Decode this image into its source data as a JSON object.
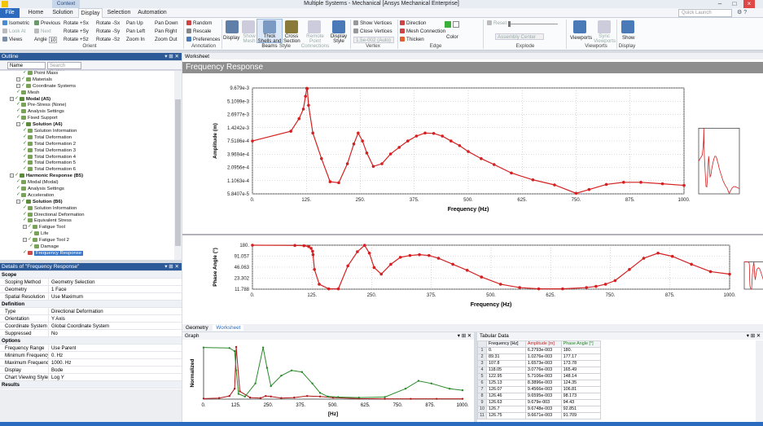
{
  "window": {
    "title": "Multiple Systems - Mechanical [Ansys Mechanical Enterprise]",
    "context_tab": "Context",
    "quick_launch_placeholder": "Quick Launch"
  },
  "ribbon_tabs": [
    "File",
    "Home",
    "Solution",
    "Display",
    "Selection",
    "Automation"
  ],
  "ribbon": {
    "orient": {
      "isometric": "Isometric",
      "look_at": "Look At",
      "views": "Views",
      "previous": "Previous",
      "next": "Next",
      "angle_label": "Angle",
      "angle_value": "10",
      "rotate_px": "Rotate +Sx",
      "rotate_py": "Rotate +Sy",
      "rotate_pz": "Rotate +Sz",
      "rotate_nx": "Rotate -Sx",
      "rotate_ny": "Rotate -Sy",
      "rotate_nz": "Rotate -Sz",
      "pan_up": "Pan Up",
      "pan_left": "Pan Left",
      "zoom_in": "Zoom In",
      "pan_down": "Pan Down",
      "pan_right": "Pan Right",
      "zoom_out": "Zoom Out",
      "group": "Orient"
    },
    "annotation": {
      "random": "Random",
      "rescale": "Rescale",
      "preferences": "Preferences",
      "group": "Annotation"
    },
    "style": {
      "display": "Display",
      "show_mesh": "Show Mesh",
      "thick_shells": "Thick Shells and Beams",
      "cross_section": "Cross Section",
      "remote_point": "Remote Point Connections",
      "display_style": "Display Style",
      "group": "Style"
    },
    "vertex": {
      "show_vertices": "Show Vertices",
      "close_vertices": "Close Vertices",
      "vertex_value": "1.5e-002 (Auto)",
      "group": "Vertex"
    },
    "edge": {
      "direction": "Direction",
      "mesh_connection": "Mesh Connection",
      "thicken": "Thicken",
      "color": "Color",
      "group": "Edge"
    },
    "explode": {
      "reset": "Reset",
      "assembly_center": "Assembly Center",
      "group": "Explode"
    },
    "viewports": {
      "viewports": "Viewports",
      "sync": "Sync Viewports",
      "group": "Viewports"
    },
    "display": {
      "show": "Show",
      "group": "Display"
    }
  },
  "outline": {
    "title": "Outline",
    "name_col": "Name",
    "search_placeholder": "Search Outline",
    "nodes": [
      {
        "label": "Point Mass",
        "depth": 2,
        "kind": "leaf"
      },
      {
        "label": "Materials",
        "depth": 1,
        "kind": "folder"
      },
      {
        "label": "Coordinate Systems",
        "depth": 1,
        "kind": "folder"
      },
      {
        "label": "Mesh",
        "depth": 1,
        "kind": "leaf"
      },
      {
        "label": "Modal (A5)",
        "depth": 0,
        "kind": "bold"
      },
      {
        "label": "Pre-Stress (None)",
        "depth": 1,
        "kind": "leaf"
      },
      {
        "label": "Analysis Settings",
        "depth": 1,
        "kind": "leaf"
      },
      {
        "label": "Fixed Support",
        "depth": 1,
        "kind": "leaf"
      },
      {
        "label": "Solution (A6)",
        "depth": 1,
        "kind": "bold"
      },
      {
        "label": "Solution Information",
        "depth": 2,
        "kind": "leaf"
      },
      {
        "label": "Total Deformation",
        "depth": 2,
        "kind": "leaf"
      },
      {
        "label": "Total Deformation 2",
        "depth": 2,
        "kind": "leaf"
      },
      {
        "label": "Total Deformation 3",
        "depth": 2,
        "kind": "leaf"
      },
      {
        "label": "Total Deformation 4",
        "depth": 2,
        "kind": "leaf"
      },
      {
        "label": "Total Deformation 5",
        "depth": 2,
        "kind": "leaf"
      },
      {
        "label": "Total Deformation 6",
        "depth": 2,
        "kind": "leaf"
      },
      {
        "label": "Harmonic Response (B5)",
        "depth": 0,
        "kind": "bold"
      },
      {
        "label": "Modal (Modal)",
        "depth": 1,
        "kind": "leaf"
      },
      {
        "label": "Analysis Settings",
        "depth": 1,
        "kind": "leaf"
      },
      {
        "label": "Acceleration",
        "depth": 1,
        "kind": "leaf"
      },
      {
        "label": "Solution (B6)",
        "depth": 1,
        "kind": "bold"
      },
      {
        "label": "Solution Information",
        "depth": 2,
        "kind": "leaf"
      },
      {
        "label": "Directional Deformation",
        "depth": 2,
        "kind": "leaf"
      },
      {
        "label": "Equivalent Stress",
        "depth": 2,
        "kind": "leaf"
      },
      {
        "label": "Fatigue Tool",
        "depth": 2,
        "kind": "folder"
      },
      {
        "label": "Life",
        "depth": 3,
        "kind": "leaf"
      },
      {
        "label": "Fatigue Tool 2",
        "depth": 2,
        "kind": "folder"
      },
      {
        "label": "Damage",
        "depth": 3,
        "kind": "leaf"
      },
      {
        "label": "Frequency Response",
        "depth": 2,
        "kind": "selected"
      }
    ]
  },
  "details": {
    "title": "Details of \"Frequency Response\"",
    "rows": [
      {
        "k": "Scope",
        "section": true
      },
      {
        "k": "Scoping Method",
        "v": "Geometry Selection"
      },
      {
        "k": "Geometry",
        "v": "1 Face"
      },
      {
        "k": "Spatial Resolution",
        "v": "Use Maximum"
      },
      {
        "k": "Definition",
        "section": true
      },
      {
        "k": "Type",
        "v": "Directional Deformation"
      },
      {
        "k": "Orientation",
        "v": "Y Axis"
      },
      {
        "k": "Coordinate System",
        "v": "Global Coordinate System"
      },
      {
        "k": "Suppressed",
        "v": "No"
      },
      {
        "k": "Options",
        "section": true
      },
      {
        "k": "Frequency Range",
        "v": "Use Parent"
      },
      {
        "k": "Minimum Frequency",
        "v": "0. Hz"
      },
      {
        "k": "Maximum Frequency",
        "v": "1000. Hz"
      },
      {
        "k": "Display",
        "v": "Bode"
      },
      {
        "k": "Chart Viewing Style",
        "v": "Log Y"
      },
      {
        "k": "Results",
        "section": true
      }
    ]
  },
  "worksheet": {
    "tab_label": "Worksheet",
    "header": "Frequency Response"
  },
  "bottom_tabs": [
    "Geometry",
    "Worksheet"
  ],
  "graph_panel": {
    "title": "Graph"
  },
  "tabular": {
    "title": "Tabular Data",
    "columns": [
      "Frequency [Hz]",
      "Amplitude [m]",
      "Phase Angle [°]"
    ],
    "rows": [
      [
        "0.",
        "6.2793e-003",
        "180."
      ],
      [
        "89.31",
        "1.0276e-003",
        "177.17"
      ],
      [
        "107.8",
        "1.6573e-003",
        "173.78"
      ],
      [
        "118.05",
        "3.0776e-003",
        "165.49"
      ],
      [
        "122.95",
        "5.7106e-003",
        "148.14"
      ],
      [
        "125.13",
        "8.3896e-003",
        "124.35"
      ],
      [
        "126.07",
        "9.4566e-003",
        "106.81"
      ],
      [
        "126.46",
        "9.6595e-003",
        "98.173"
      ],
      [
        "126.63",
        "9.679e-003",
        "94.43"
      ],
      [
        "126.7",
        "9.6748e-003",
        "92.851"
      ],
      [
        "126.75",
        "9.6671e-003",
        "91.709"
      ]
    ]
  },
  "chart_data": [
    {
      "type": "line",
      "xlabel": "Frequency (Hz)",
      "ylabel": "Amplitude (m)",
      "x_ticks": [
        "0.",
        "125.",
        "250.",
        "375.",
        "500.",
        "625.",
        "750.",
        "875.",
        "1000."
      ],
      "y_ticks": [
        "9.679e-3",
        "5.1099e-3",
        "2.6977e-3",
        "1.4242e-3",
        "7.5186e-4",
        "3.9694e-4",
        "2.0956e-4",
        "1.1063e-4",
        "5.8407e-5"
      ],
      "xlim": [
        0,
        1000
      ],
      "y_scale": "log",
      "series": [
        {
          "x": [
            0,
            89,
            108,
            118,
            123,
            126,
            127,
            130,
            140,
            160,
            180,
            200,
            220,
            235,
            245,
            255,
            265,
            280,
            300,
            320,
            340,
            360,
            380,
            400,
            420,
            440,
            460,
            480,
            500,
            530,
            560,
            600,
            650,
            700,
            750,
            780,
            820,
            860,
            900,
            950,
            1000
          ],
          "y": [
            0.00075,
            0.0012,
            0.0022,
            0.0035,
            0.0065,
            0.0095,
            0.0094,
            0.0042,
            0.0011,
            0.00032,
            0.000105,
            0.0001,
            0.00025,
            0.00065,
            0.0011,
            0.00075,
            0.00042,
            0.00022,
            0.00025,
            0.0004,
            0.00055,
            0.00075,
            0.00095,
            0.0011,
            0.00108,
            0.00095,
            0.00075,
            0.0006,
            0.00045,
            0.00032,
            0.00024,
            0.00016,
            0.000115,
            9e-05,
            6e-05,
            7.2e-05,
            9.2e-05,
            0.000102,
            0.000102,
            9.5e-05,
            8.8e-05
          ]
        }
      ]
    },
    {
      "type": "line",
      "xlabel": "Frequency (Hz)",
      "ylabel": "Phase Angle (°)",
      "x_ticks": [
        "0.",
        "125.",
        "250.",
        "375.",
        "500.",
        "625.",
        "750.",
        "875.",
        "1000."
      ],
      "y_ticks": [
        "180.",
        "91.057",
        "46.063",
        "23.302",
        "11.788"
      ],
      "xlim": [
        0,
        1000
      ],
      "series": [
        {
          "x": [
            0,
            89,
            108,
            118,
            123,
            126,
            127,
            130,
            140,
            160,
            180,
            200,
            220,
            235,
            245,
            255,
            270,
            290,
            310,
            330,
            350,
            370,
            390,
            420,
            450,
            480,
            520,
            560,
            600,
            650,
            700,
            720,
            740,
            760,
            790,
            820,
            850,
            880,
            920,
            960,
            1000
          ],
          "y": [
            180,
            177,
            174,
            165,
            148,
            124,
            100,
            40,
            16,
            12,
            12,
            50,
            120,
            178,
            110,
            45,
            30,
            55,
            85,
            95,
            100,
            95,
            80,
            55,
            38,
            25,
            16,
            13,
            12,
            12,
            13,
            14,
            16,
            20,
            40,
            80,
            110,
            90,
            55,
            35,
            30
          ]
        }
      ]
    },
    {
      "type": "line",
      "xlabel": "[Hz]",
      "ylabel": "Normalized",
      "x_ticks": [
        "0.",
        "125.",
        "250.",
        "375.",
        "500.",
        "625.",
        "750.",
        "875.",
        "1000."
      ],
      "series": [
        {
          "x": [
            0,
            60,
            100,
            120,
            126,
            140,
            180,
            220,
            240,
            260,
            300,
            350,
            400,
            450,
            500,
            600,
            700,
            800,
            900,
            1000
          ],
          "y": [
            0.01,
            0.02,
            0.06,
            0.2,
            1.0,
            0.15,
            0.03,
            0.02,
            0.06,
            0.05,
            0.02,
            0.03,
            0.06,
            0.05,
            0.03,
            0.01,
            0.005,
            0.005,
            0.005,
            0.005
          ]
        },
        {
          "x": [
            0,
            100,
            120,
            126,
            135,
            160,
            200,
            230,
            245,
            260,
            300,
            340,
            380,
            420,
            450,
            480,
            520,
            600,
            700,
            780,
            830,
            880,
            950,
            1000
          ],
          "y": [
            0.99,
            0.98,
            0.92,
            0.55,
            0.1,
            0.05,
            0.3,
            0.99,
            0.6,
            0.25,
            0.45,
            0.55,
            0.52,
            0.3,
            0.12,
            0.05,
            0.04,
            0.03,
            0.04,
            0.2,
            0.35,
            0.3,
            0.2,
            0.17
          ]
        }
      ]
    }
  ]
}
